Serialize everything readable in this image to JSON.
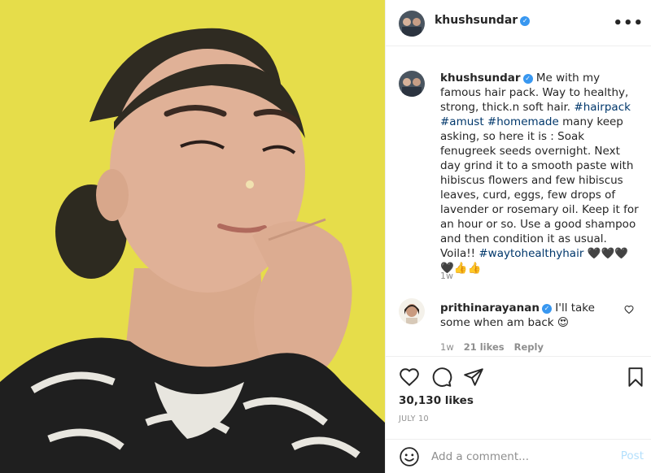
{
  "post": {
    "username": "khushsundar",
    "verified": true,
    "more_icon": "more-horizontal-icon",
    "more_text": "•••"
  },
  "caption": {
    "username": "khushsundar",
    "text_1": " Me with my famous hair pack. Way to healthy, strong, thick.n soft hair. ",
    "tag_1": "#hairpack",
    "space_1": " ",
    "tag_2": "#amust",
    "space_2": " ",
    "tag_3": "#homemade",
    "text_2": " many keep asking, so here it is : Soak fenugreek seeds overnight. Next day grind it to a smooth paste with hibiscus flowers and few hibiscus leaves, curd, eggs, few drops of lavender or rosemary oil. Keep it for an hour or so. Use a good shampoo and then condition it as usual. Voila!! ",
    "tag_4": "#waytohealthyhair",
    "emojis": " 🖤🖤🖤 🖤👍👍",
    "time": "1w"
  },
  "reply": {
    "username": "prithinarayanan",
    "verified": true,
    "text": " I'll take some when am back 😍",
    "time": "1w",
    "likes": "21 likes",
    "reply_label": "Reply"
  },
  "actions": {
    "likes": "30,130 likes",
    "date": "JULY 10"
  },
  "add_comment": {
    "placeholder": "Add a comment...",
    "post_label": "Post"
  },
  "colors": {
    "link": "#00376b",
    "verified": "#3897f0",
    "post_button": "#b2dffc",
    "muted": "#8e8e8e",
    "background_photo": "#e5dc47"
  }
}
